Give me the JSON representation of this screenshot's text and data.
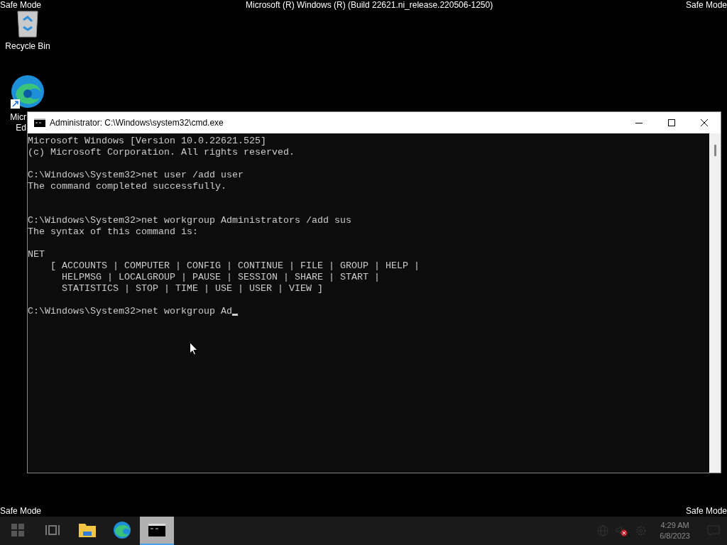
{
  "desktop": {
    "top_title": "Microsoft (R) Windows (R) (Build 22621.ni_release.220506-1250)",
    "corner_labels": [
      "Safe Mode",
      "Safe Mode",
      "Safe Mode",
      "Safe Mode"
    ],
    "icons": [
      {
        "kind": "recycle",
        "label_lines": [
          "Recycle Bin"
        ]
      },
      {
        "kind": "edge",
        "label_lines": [
          "Micr",
          "Ed"
        ]
      }
    ]
  },
  "window": {
    "title": "Administrator: C:\\Windows\\system32\\cmd.exe",
    "lines": [
      {
        "kind": "text",
        "text": "Microsoft Windows [Version 10.0.22621.525]"
      },
      {
        "kind": "text",
        "text": "(c) Microsoft Corporation. All rights reserved."
      },
      {
        "kind": "blank"
      },
      {
        "kind": "text",
        "text": "C:\\Windows\\System32>net user /add user"
      },
      {
        "kind": "text",
        "text": "The command completed successfully."
      },
      {
        "kind": "blank"
      },
      {
        "kind": "blank"
      },
      {
        "kind": "text",
        "text": "C:\\Windows\\System32>net workgroup Administrators /add sus"
      },
      {
        "kind": "text",
        "text": "The syntax of this command is:"
      },
      {
        "kind": "blank"
      },
      {
        "kind": "text",
        "text": "NET"
      },
      {
        "kind": "text",
        "text": "    [ ACCOUNTS | COMPUTER | CONFIG | CONTINUE | FILE | GROUP | HELP |"
      },
      {
        "kind": "text",
        "text": "      HELPMSG | LOCALGROUP | PAUSE | SESSION | SHARE | START |"
      },
      {
        "kind": "text",
        "text": "      STATISTICS | STOP | TIME | USE | USER | VIEW ]"
      },
      {
        "kind": "blank"
      },
      {
        "kind": "prompt",
        "text": "C:\\Windows\\System32>net workgroup Ad"
      }
    ]
  },
  "taskbar": {
    "items": [
      {
        "kind": "start",
        "selected": false
      },
      {
        "kind": "taskview",
        "selected": false
      },
      {
        "kind": "folder",
        "selected": false
      },
      {
        "kind": "edge",
        "selected": false
      },
      {
        "kind": "cmd",
        "selected": true
      }
    ],
    "tray": {
      "time": "4:29 AM",
      "date": "6/8/2023"
    }
  }
}
